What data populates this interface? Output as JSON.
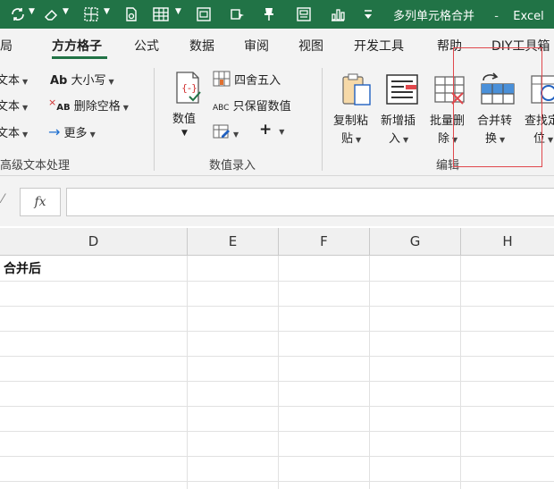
{
  "window": {
    "title": "多列单元格合并",
    "app": "Excel"
  },
  "tabs": [
    {
      "label": "布局",
      "active": false
    },
    {
      "label": "方方格子",
      "active": true
    },
    {
      "label": "公式",
      "active": false
    },
    {
      "label": "数据",
      "active": false
    },
    {
      "label": "审阅",
      "active": false
    },
    {
      "label": "视图",
      "active": false
    },
    {
      "label": "开发工具",
      "active": false
    },
    {
      "label": "帮助",
      "active": false
    },
    {
      "label": "DIY工具箱",
      "active": false
    }
  ],
  "ribbon": {
    "text_group": {
      "left_items": [
        "文本",
        "文本",
        "文本"
      ],
      "case_label": "大小写",
      "case_icon_text": "Ab",
      "remove_space_label": "删除空格",
      "remove_space_icon_text": "AB",
      "more_label": "更多",
      "group_label": "高级文本处理"
    },
    "number_group": {
      "value_label": "数值",
      "round_label": "四舍五入",
      "keep_value_label": "只保留数值",
      "keep_value_icon_text": "ABC",
      "plus_label": "+",
      "group_label": "数值录入"
    },
    "edit_group": {
      "copy_paste_label_1": "复制粘",
      "copy_paste_label_2": "贴",
      "insert_label_1": "新增插",
      "insert_label_2": "入",
      "batch_delete_label_1": "批量删",
      "batch_delete_label_2": "除",
      "merge_label_1": "合并转",
      "merge_label_2": "换",
      "find_label_1": "查找定",
      "find_label_2": "位",
      "group_label": "编辑"
    }
  },
  "formula_bar": {
    "fx_label": "fx",
    "value": ""
  },
  "grid": {
    "columns": [
      "D",
      "E",
      "F",
      "G",
      "H"
    ],
    "cells": {
      "D1": "合并后"
    }
  },
  "colors": {
    "title_bar": "#217346",
    "ribbon_bg": "#f3f3f3",
    "highlight": "#e0474c",
    "accent_blue": "#1e6fd0"
  }
}
